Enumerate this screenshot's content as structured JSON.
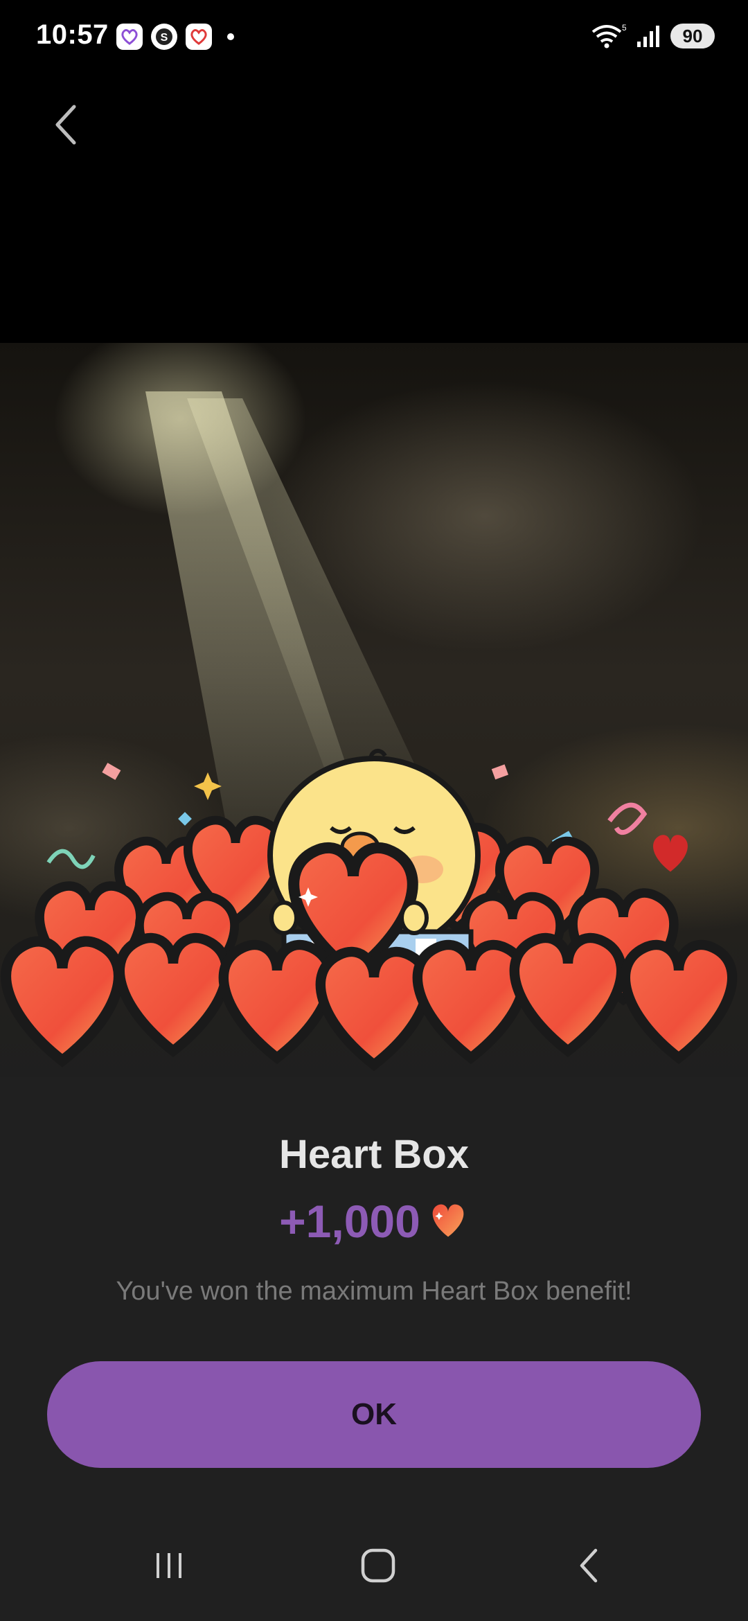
{
  "status_bar": {
    "time": "10:57",
    "notification_icons": [
      "heart-chat-icon",
      "s-coin-icon",
      "heart-chat-red-icon"
    ],
    "battery": "90",
    "network": "5"
  },
  "header": {
    "back_icon": "chevron-left-icon"
  },
  "reward": {
    "title": "Heart Box",
    "amount": "+1,000",
    "message": "You've won the maximum Heart Box benefit!",
    "ok_label": "OK"
  },
  "colors": {
    "accent": "#8956ae",
    "amount": "#8d5bb5",
    "heart": "#f0573f",
    "sheet_bg": "#202020"
  },
  "nav_bar": {
    "recents_icon": "recents-icon",
    "home_icon": "home-icon",
    "back_icon": "back-icon"
  }
}
